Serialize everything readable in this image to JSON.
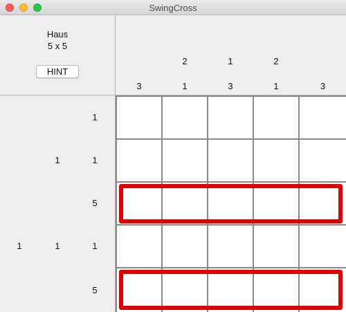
{
  "window": {
    "title": "SwingCross"
  },
  "puzzle": {
    "name": "Haus",
    "size": "5 x 5"
  },
  "buttons": {
    "hint": "HINT"
  },
  "column_clues": [
    [
      "3"
    ],
    [
      "2",
      "1"
    ],
    [
      "1",
      "3"
    ],
    [
      "2",
      "1"
    ],
    [
      "3"
    ]
  ],
  "row_clues": [
    [
      "1"
    ],
    [
      "1",
      "1"
    ],
    [
      "5"
    ],
    [
      "1",
      "1",
      "1"
    ],
    [
      "5"
    ]
  ],
  "grid": {
    "rows": 5,
    "cols": 5
  },
  "hint_rows": [
    2,
    4
  ],
  "colors": {
    "hint_highlight": "#e00000",
    "grid_line": "#8a8a8a",
    "cell": "#ffffff"
  }
}
